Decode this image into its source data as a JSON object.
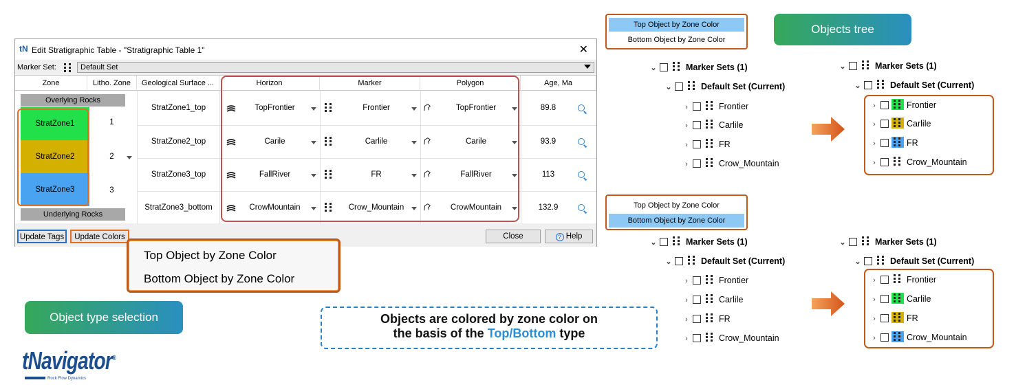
{
  "dialog": {
    "logo": "tN",
    "title": "Edit Stratigraphic Table - \"Stratigraphic Table 1\"",
    "close": "✕",
    "marker_set_label": "Marker Set:",
    "marker_set_value": "Default Set",
    "headers": [
      "Zone",
      "Litho. Zone",
      "Geological Surface ...",
      "Horizon",
      "Marker",
      "Polygon",
      "Age, Ma"
    ],
    "overlying": "Overlying Rocks",
    "underlying": "Underlying Rocks",
    "zones": [
      {
        "name": "StratZone1",
        "litho": "1",
        "color": "#22e04a"
      },
      {
        "name": "StratZone2",
        "litho": "2",
        "color": "#d4b000"
      },
      {
        "name": "StratZone3",
        "litho": "3",
        "color": "#4aa3f0"
      }
    ],
    "rows": [
      {
        "surface": "StratZone1_top",
        "horizon": "TopFrontier",
        "marker": "Frontier",
        "polygon": "TopFrontier",
        "age": "89.8"
      },
      {
        "surface": "StratZone2_top",
        "horizon": "Carile",
        "marker": "Carlile",
        "polygon": "Carile",
        "age": "93.9"
      },
      {
        "surface": "StratZone3_top",
        "horizon": "FallRiver",
        "marker": "FR",
        "polygon": "FallRiver",
        "age": "113"
      },
      {
        "surface": "StratZone3_bottom",
        "horizon": "CrowMountain",
        "marker": "Crow_Mountain",
        "polygon": "CrowMountain",
        "age": "132.9"
      }
    ],
    "buttons": {
      "update_tags": "Update Tags",
      "update_colors": "Update Colors",
      "close": "Close",
      "help": "Help"
    }
  },
  "popup": {
    "top": "Top Object by Zone Color",
    "bottom": "Bottom Object by Zone Color"
  },
  "badges": {
    "selection": "Object type selection",
    "tree": "Objects tree"
  },
  "note": {
    "line1": "Objects are colored by zone color on",
    "line2_pre": "the basis of the ",
    "line2_hl": "Top/Bottom",
    "line2_post": " type"
  },
  "mini_top": {
    "selected": "Top Object by Zone Color",
    "other": "Bottom Object by Zone Color"
  },
  "mini_bottom": {
    "other": "Top Object by Zone Color",
    "selected": "Bottom Object by Zone Color"
  },
  "tree": {
    "root": "Marker Sets (1)",
    "set": "Default Set  (Current)",
    "items": [
      "Frontier",
      "Carlile",
      "FR",
      "Crow_Mountain"
    ]
  },
  "logo": {
    "name": "tNavigator",
    "reg": "®",
    "sub": "Rock Flow Dynamics"
  },
  "colors": {
    "green": "#22e04a",
    "yellow": "#d4b000",
    "blue": "#4aa3f0",
    "accent": "#c05a1a",
    "selected_row": "#8ec8f5"
  }
}
